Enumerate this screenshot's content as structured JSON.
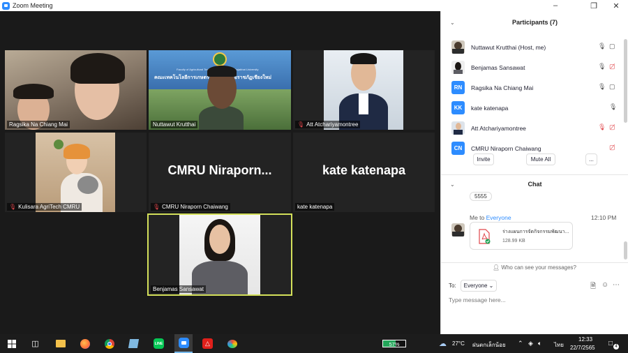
{
  "window": {
    "title": "Zoom Meeting"
  },
  "tiles": [
    {
      "name": "Ragsika Na Chiang Mai",
      "muted": false
    },
    {
      "name": "Nuttawut Krutthai",
      "muted": false,
      "banner_text": "คณะเทคโนโลยีการเกษตร มหาวิทยาลัยราชภัฏเชียงใหม่",
      "banner_sub": "Faculty of Agricultural Technology, Chiang Mai Rajabhat University"
    },
    {
      "name": "Att Atchariyamontree",
      "muted": true
    },
    {
      "name": "Kulisara AgriTech CMRU",
      "muted": true
    },
    {
      "name": "CMRU Niraporn Chaiwang",
      "muted": true,
      "big_label": "CMRU  Niraporn..."
    },
    {
      "name": "kate katenapa",
      "muted": false,
      "big_label": "kate katenapa"
    },
    {
      "name": "Benjamas Sansawat",
      "muted": false,
      "active_speaker": true
    }
  ],
  "participants": {
    "header": "Participants (7)",
    "list": [
      {
        "name": "Nuttawut Krutthai (Host, me)",
        "initials": "",
        "mic": "on",
        "video": "on"
      },
      {
        "name": "Benjamas Sansawat",
        "initials": "",
        "mic": "on",
        "video": "off"
      },
      {
        "name": "Ragsika Na Chiang Mai",
        "initials": "RN",
        "mic": "on",
        "video": "on"
      },
      {
        "name": "kate katenapa",
        "initials": "KK",
        "mic": "on",
        "video": ""
      },
      {
        "name": "Att Atchariyamontree",
        "initials": "",
        "mic": "off",
        "video": "off"
      },
      {
        "name": "CMRU Niraporn Chaiwang",
        "initials": "CN",
        "mic": "",
        "video": "off"
      }
    ],
    "invite_label": "Invite",
    "mute_all_label": "Mute All",
    "more_label": "..."
  },
  "chat": {
    "header": "Chat",
    "prev_message": "5555",
    "sender_prefix": "Me to",
    "recipient": "Everyone",
    "time": "12:10 PM",
    "file_name": "ร่างแผนการจัดกิจกรรมพัฒนา...",
    "file_size": "128.99 KB",
    "who_can_see": "Who can see your messages?",
    "to_label": "To:",
    "to_value": "Everyone",
    "placeholder": "Type message here..."
  },
  "taskbar": {
    "battery": "57%",
    "weather_temp": "27°C",
    "weather_desc": "ฝนตกเล็กน้อย",
    "lang": "ไทย",
    "time": "12:33",
    "date": "22/7/2565",
    "notifications": "4"
  },
  "colors": {
    "zoom_blue": "#2d8cff",
    "active_border": "#d4e05a",
    "mute_red": "#e0464b"
  }
}
